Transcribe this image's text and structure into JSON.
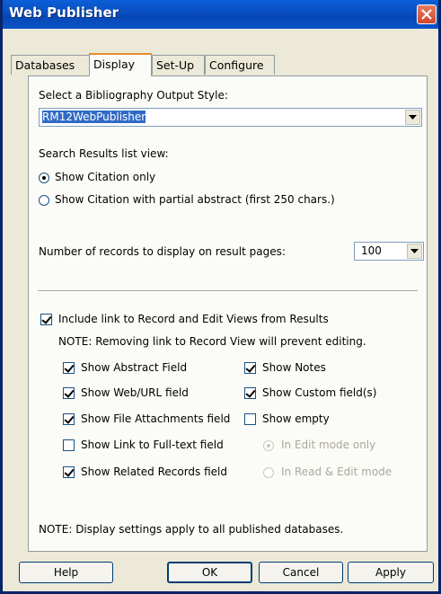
{
  "window": {
    "title": "Web Publisher"
  },
  "tabs": [
    {
      "label": "Databases"
    },
    {
      "label": "Display"
    },
    {
      "label": "Set-Up"
    },
    {
      "label": "Configure"
    }
  ],
  "display": {
    "style_label": "Select a Bibliography Output Style:",
    "style_value": "RM12WebPublisher",
    "search_view_label": "Search Results list view:",
    "radio_citation_only": "Show Citation only",
    "radio_citation_abstract": "Show Citation with partial abstract (first 250 chars.)",
    "records_label": "Number of records to display on result pages:",
    "records_value": "100",
    "include_link_label": "Include link to Record and Edit Views from Results",
    "include_link_note": "NOTE: Removing link to Record View will prevent editing.",
    "checks": {
      "abstract": "Show Abstract Field",
      "web_url": "Show Web/URL field",
      "file_attachments": "Show File Attachments field",
      "link_fulltext": "Show Link to Full-text field",
      "related_records": "Show Related Records field",
      "notes": "Show Notes",
      "custom_fields": "Show Custom field(s)",
      "show_empty": "Show empty"
    },
    "mode_edit_only": "In Edit mode only",
    "mode_read_edit": "In Read & Edit mode",
    "footer_note": "NOTE: Display settings apply to all published databases."
  },
  "buttons": {
    "help": "Help",
    "ok": "OK",
    "cancel": "Cancel",
    "apply": "Apply"
  },
  "colors": {
    "titlebar": "#0a4ec0",
    "selection": "#316ac5",
    "active_tab": "#e68b2c"
  }
}
